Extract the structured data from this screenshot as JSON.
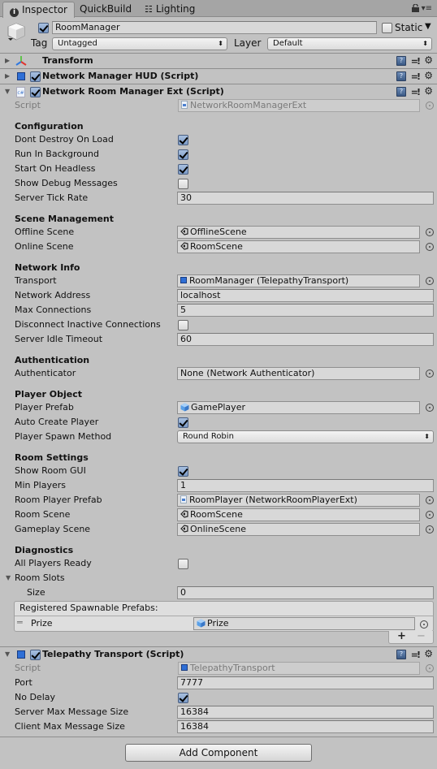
{
  "tabs": [
    {
      "label": "Inspector",
      "icon": "info-icon",
      "active": true
    },
    {
      "label": "QuickBuild",
      "icon": null,
      "active": false
    },
    {
      "label": "Lighting",
      "icon": "lighting-icon",
      "active": false
    }
  ],
  "header": {
    "active": true,
    "name": "RoomManager",
    "static_label": "Static",
    "static": false,
    "tag_label": "Tag",
    "tag_value": "Untagged",
    "layer_label": "Layer",
    "layer_value": "Default"
  },
  "components": {
    "transform": {
      "title": "Transform"
    },
    "hud": {
      "title": "Network Manager HUD (Script)",
      "enabled": true
    },
    "room_manager": {
      "title": "Network Room Manager Ext (Script)",
      "enabled": true,
      "script_label": "Script",
      "script_value": "NetworkRoomManagerExt",
      "configuration": {
        "heading": "Configuration",
        "dont_destroy_label": "Dont Destroy On Load",
        "dont_destroy": true,
        "run_bg_label": "Run In Background",
        "run_bg": true,
        "headless_label": "Start On Headless",
        "headless": true,
        "debug_label": "Show Debug Messages",
        "debug": false,
        "tick_label": "Server Tick Rate",
        "tick": "30"
      },
      "scene_management": {
        "heading": "Scene Management",
        "offline_label": "Offline Scene",
        "offline": "OfflineScene",
        "online_label": "Online Scene",
        "online": "RoomScene"
      },
      "network_info": {
        "heading": "Network Info",
        "transport_label": "Transport",
        "transport": "RoomManager (TelepathyTransport)",
        "address_label": "Network Address",
        "address": "localhost",
        "max_conn_label": "Max Connections",
        "max_conn": "5",
        "disconnect_label": "Disconnect Inactive Connections",
        "disconnect": false,
        "idle_label": "Server Idle Timeout",
        "idle": "60"
      },
      "authentication": {
        "heading": "Authentication",
        "auth_label": "Authenticator",
        "auth": "None (Network Authenticator)"
      },
      "player_object": {
        "heading": "Player Object",
        "prefab_label": "Player Prefab",
        "prefab": "GamePlayer",
        "auto_create_label": "Auto Create Player",
        "auto_create": true,
        "spawn_label": "Player Spawn Method",
        "spawn": "Round Robin"
      },
      "room_settings": {
        "heading": "Room Settings",
        "gui_label": "Show Room GUI",
        "gui": true,
        "min_players_label": "Min Players",
        "min_players": "1",
        "room_prefab_label": "Room Player Prefab",
        "room_prefab": "RoomPlayer (NetworkRoomPlayerExt)",
        "room_scene_label": "Room Scene",
        "room_scene": "RoomScene",
        "gameplay_scene_label": "Gameplay Scene",
        "gameplay_scene": "OnlineScene"
      },
      "diagnostics": {
        "heading": "Diagnostics",
        "ready_label": "All Players Ready",
        "ready": false,
        "slots_label": "Room Slots",
        "size_label": "Size",
        "size": "0"
      },
      "spawnables": {
        "heading": "Registered Spawnable Prefabs:",
        "items": [
          {
            "label": "Prize",
            "value": "Prize"
          }
        ],
        "add_label": "+",
        "remove_label": "−"
      }
    },
    "telepathy": {
      "title": "Telepathy Transport (Script)",
      "enabled": true,
      "script_label": "Script",
      "script_value": "TelepathyTransport",
      "port_label": "Port",
      "port": "7777",
      "nodelay_label": "No Delay",
      "nodelay": true,
      "server_max_label": "Server Max Message Size",
      "server_max": "16384",
      "client_max_label": "Client Max Message Size",
      "client_max": "16384"
    }
  },
  "add_component_label": "Add Component"
}
